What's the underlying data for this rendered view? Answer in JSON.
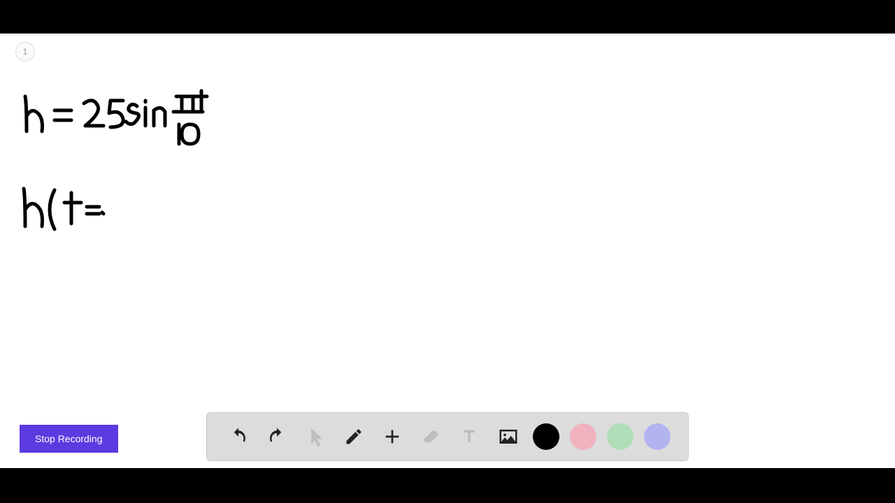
{
  "page_number": "1",
  "stop_button_label": "Stop Recording",
  "handwriting": {
    "line1": "h = 25 sin πt / 10",
    "line2": "h(t="
  },
  "toolbar": {
    "items": [
      {
        "name": "undo",
        "interactable": true
      },
      {
        "name": "redo",
        "interactable": true
      },
      {
        "name": "cursor",
        "interactable": true,
        "disabled": true
      },
      {
        "name": "pencil",
        "interactable": true
      },
      {
        "name": "add",
        "interactable": true
      },
      {
        "name": "eraser",
        "interactable": true,
        "disabled": true
      },
      {
        "name": "text",
        "interactable": true,
        "disabled": true
      },
      {
        "name": "image",
        "interactable": true
      }
    ],
    "colors": {
      "black": "#000000",
      "pink": "#f0b2bf",
      "green": "#b0deb8",
      "purple": "#b3b3f0"
    },
    "selected_color": "black"
  }
}
